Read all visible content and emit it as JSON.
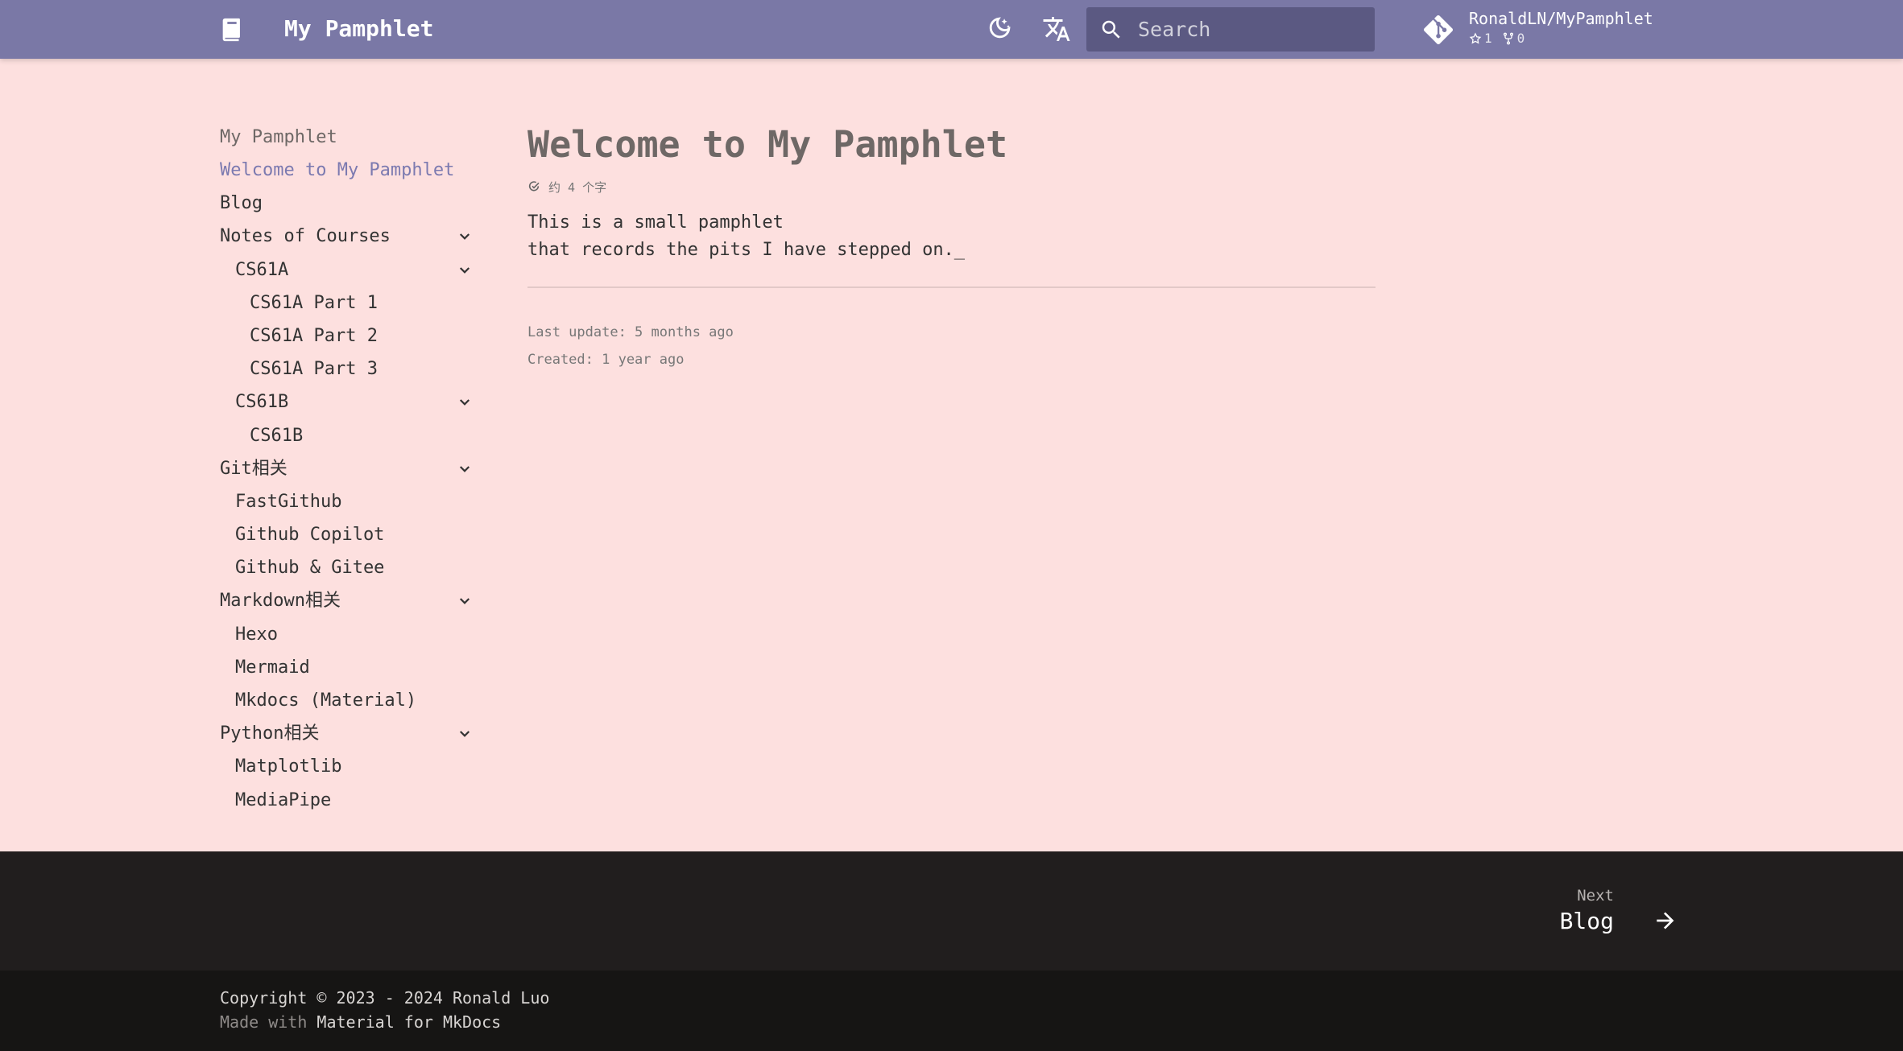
{
  "header": {
    "site_title": "My Pamphlet",
    "search_placeholder": "Search",
    "repo": {
      "name": "RonaldLN/MyPamphlet",
      "stars": "1",
      "forks": "0"
    }
  },
  "nav": {
    "title": "My Pamphlet",
    "items": [
      {
        "label": "Welcome to My Pamphlet"
      },
      {
        "label": "Blog"
      },
      {
        "label": "Notes of Courses"
      },
      {
        "label": "CS61A"
      },
      {
        "label": "CS61A Part 1"
      },
      {
        "label": "CS61A Part 2"
      },
      {
        "label": "CS61A Part 3"
      },
      {
        "label": "CS61B"
      },
      {
        "label": "CS61B"
      },
      {
        "label": "Git相关"
      },
      {
        "label": "FastGithub"
      },
      {
        "label": "Github Copilot"
      },
      {
        "label": "Github & Gitee"
      },
      {
        "label": "Markdown相关"
      },
      {
        "label": "Hexo"
      },
      {
        "label": "Mermaid"
      },
      {
        "label": "Mkdocs (Material)"
      },
      {
        "label": "Python相关"
      },
      {
        "label": "Matplotlib"
      },
      {
        "label": "MediaPipe"
      }
    ]
  },
  "content": {
    "title": "Welcome to My Pamphlet",
    "word_count": "约 4 个字",
    "lines": [
      "This is a small pamphlet",
      "that records the pits I have stepped on._"
    ],
    "last_update": "Last update: 5 months ago",
    "created": "Created: 1 year ago"
  },
  "footer": {
    "next_label": "Next",
    "next_title": "Blog",
    "copyright": "Copyright © 2023 - 2024 Ronald Luo",
    "made_with_prefix": "Made with",
    "made_with_link": "Material for MkDocs"
  },
  "colors": {
    "header_bg": "#7a78a6",
    "page_bg": "#fde0df",
    "active_link": "#7c7ab0",
    "footer_bg": "#211e1e",
    "footer_meta_bg": "#161514"
  },
  "icons": {
    "logo": "book-icon",
    "theme_toggle": "moon-star-icon",
    "language": "translate-icon",
    "search": "search-icon",
    "repo": "git-icon",
    "next": "arrow-right-icon"
  }
}
